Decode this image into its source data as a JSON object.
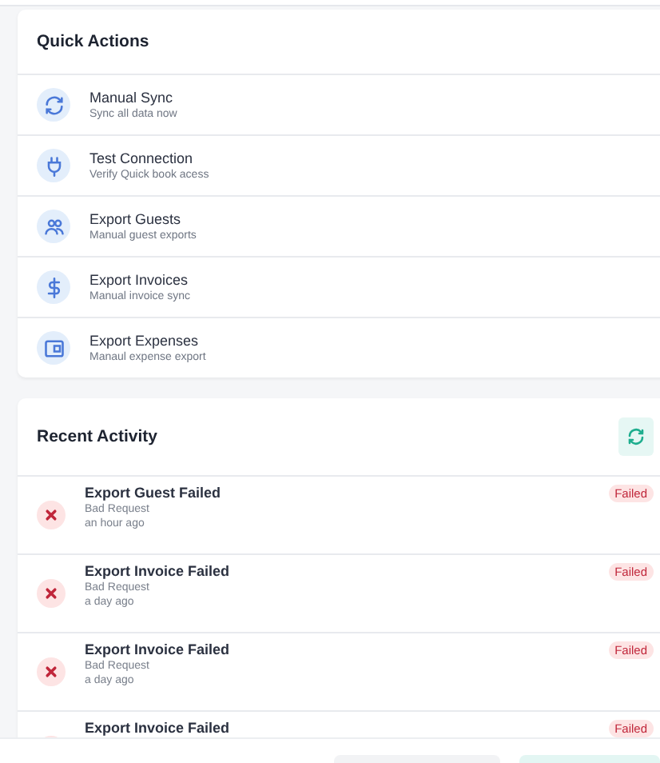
{
  "quick_actions": {
    "title": "Quick Actions",
    "items": [
      {
        "kind": "sync",
        "label": "Manual Sync",
        "description": "Sync all data now"
      },
      {
        "kind": "plug",
        "label": "Test Connection",
        "description": "Verify Quick book acess"
      },
      {
        "kind": "guests",
        "label": "Export Guests",
        "description": "Manual guest exports"
      },
      {
        "kind": "dollar",
        "label": "Export Invoices",
        "description": "Manual invoice sync"
      },
      {
        "kind": "wallet",
        "label": "Export Expenses",
        "description": "Manaul expense export"
      }
    ]
  },
  "recent_activity": {
    "title": "Recent Activity",
    "items": [
      {
        "failed": true,
        "title": "Export Guest Failed",
        "detail": "Bad Request",
        "time": "an hour ago",
        "status": "Failed"
      },
      {
        "failed": true,
        "title": "Export Invoice Failed",
        "detail": "Bad Request",
        "time": "a day ago",
        "status": "Failed"
      },
      {
        "failed": true,
        "title": "Export Invoice Failed",
        "detail": "Bad Request",
        "time": "a day ago",
        "status": "Failed"
      },
      {
        "failed": true,
        "title": "Export Invoice Failed",
        "status": "Failed"
      }
    ]
  }
}
